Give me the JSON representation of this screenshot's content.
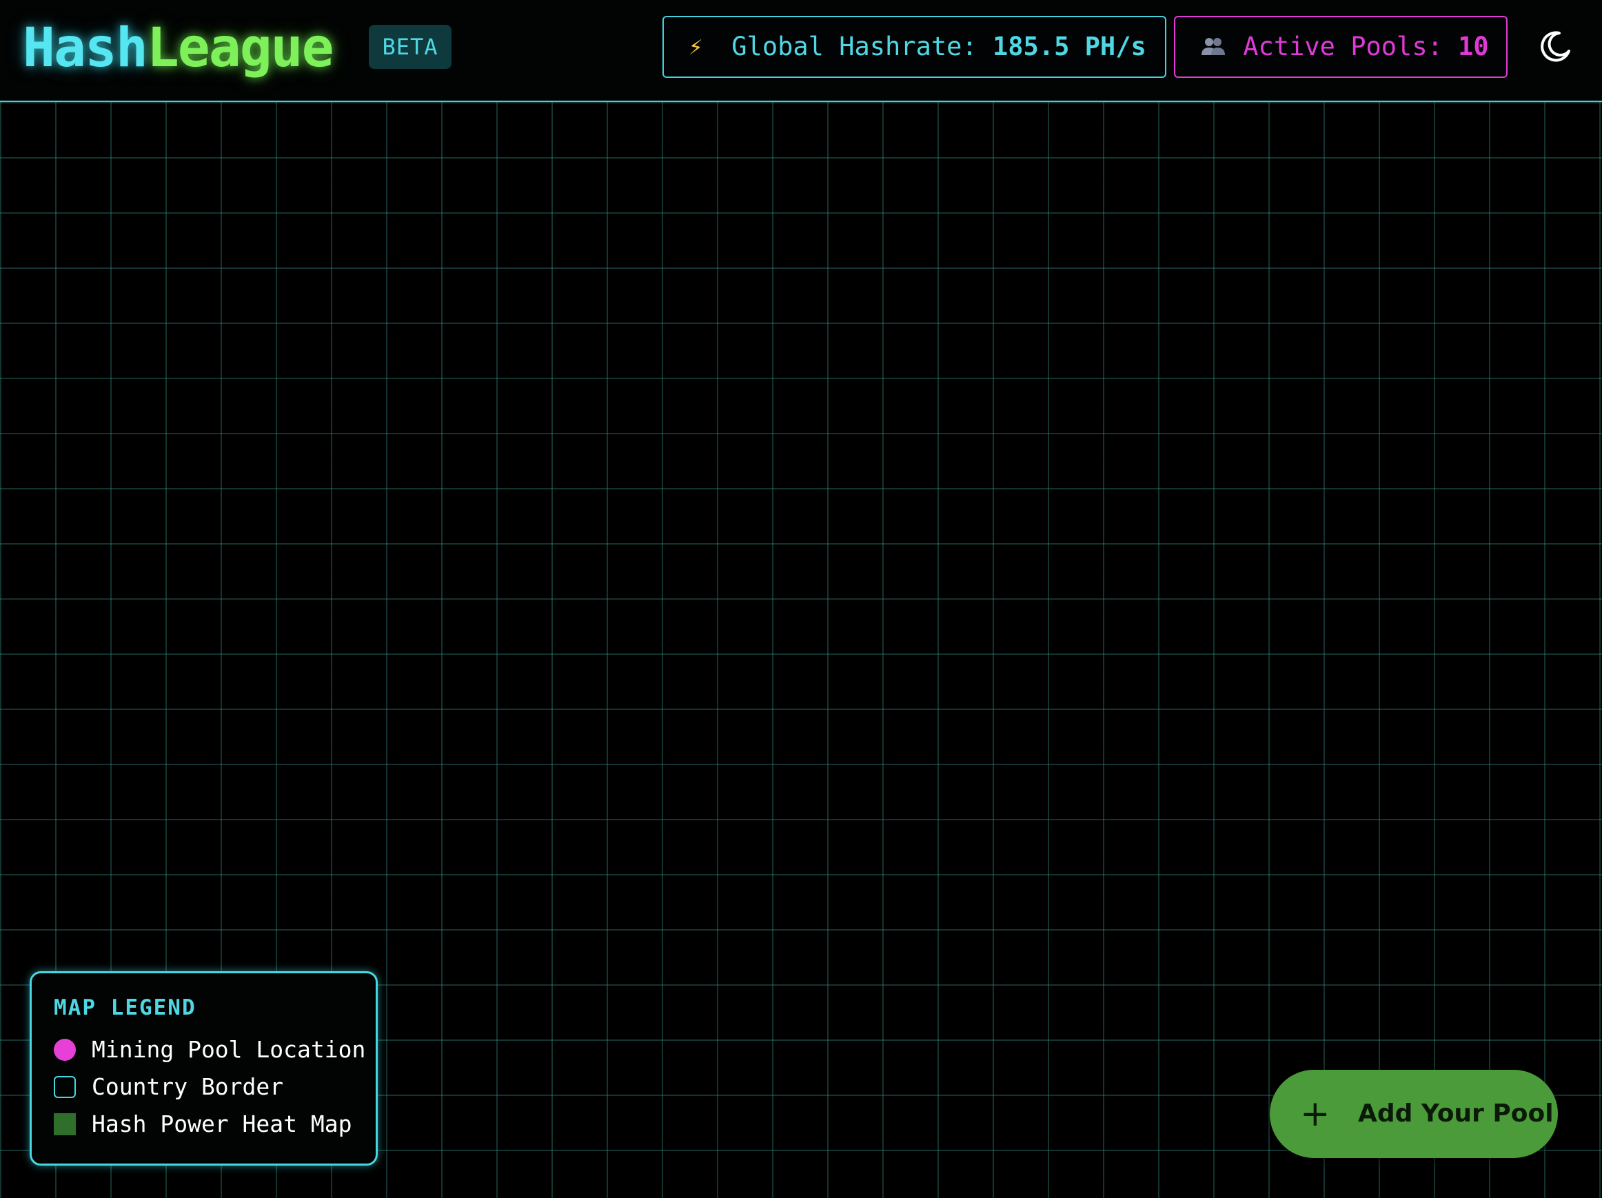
{
  "app": {
    "logo_part1": "Hash",
    "logo_part2": "League",
    "badge": "BETA"
  },
  "stats": {
    "hashrate": {
      "icon": "lightning-bolt-icon",
      "label": "Global Hashrate: ",
      "value": "185.5 PH/s"
    },
    "pools": {
      "icon": "users-icon",
      "label": "Active Pools: ",
      "value": "10"
    }
  },
  "theme_toggle": {
    "icon": "moon-icon"
  },
  "legend": {
    "title": "MAP LEGEND",
    "items": [
      {
        "label": "Mining Pool Location",
        "swatch": "magenta-dot",
        "color": "#e640d8"
      },
      {
        "label": "Country Border",
        "swatch": "cyan-outline",
        "color": "#46d8e2"
      },
      {
        "label": "Hash Power Heat Map",
        "swatch": "green-square",
        "color": "#2f6e2b"
      }
    ]
  },
  "fab": {
    "icon": "plus-icon",
    "label": "Add Your Pool"
  },
  "colors": {
    "accent_cyan": "#4fd8e3",
    "accent_magenta": "#e03ad6",
    "accent_green": "#7ef05a",
    "fab_green": "#4b9b3a"
  }
}
